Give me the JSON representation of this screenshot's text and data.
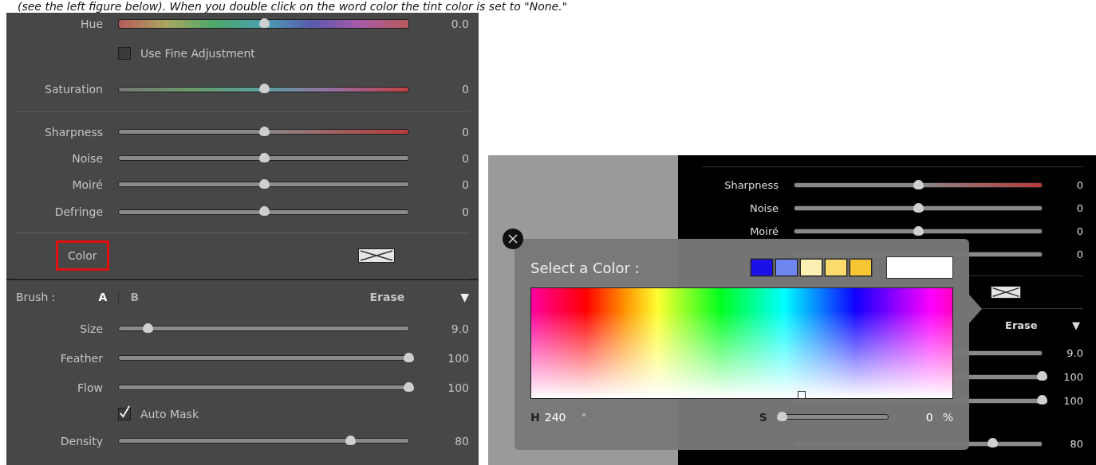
{
  "caption": "(see the left figure below).  When you double click on the word color the tint color is set to \"None.\"",
  "left_panel": {
    "sections": [
      {
        "rows": [
          {
            "kind": "hue",
            "label": "Hue",
            "level": 0.5,
            "value": "0.0"
          },
          {
            "kind": "checkbox",
            "label": "Use Fine Adjustment",
            "checked": false
          },
          {
            "kind": "saturation",
            "label": "Saturation",
            "level": 0.5,
            "value": "0"
          }
        ]
      },
      {
        "rows": [
          {
            "kind": "tinted",
            "label": "Sharpness",
            "level": 0.5,
            "value": "0"
          },
          {
            "kind": "slider",
            "label": "Noise",
            "level": 0.5,
            "value": "0"
          },
          {
            "kind": "slider",
            "label": "Moiré",
            "level": 0.5,
            "value": "0"
          },
          {
            "kind": "slider",
            "label": "Defringe",
            "level": 0.5,
            "value": "0"
          }
        ]
      },
      {
        "rows": [
          {
            "kind": "color",
            "label": "Color",
            "highlighted": true
          }
        ]
      }
    ],
    "brush": {
      "label": "Brush :",
      "options": [
        {
          "label": "A",
          "selected": true
        },
        {
          "label": "B",
          "selected": false
        }
      ],
      "erase": "Erase",
      "menu": "▼"
    },
    "brush_rows": [
      {
        "kind": "slider",
        "label": "Size",
        "level": 0.1,
        "value": "9.0"
      },
      {
        "kind": "slider",
        "label": "Feather",
        "level": 1.0,
        "value": "100"
      },
      {
        "kind": "slider",
        "label": "Flow",
        "level": 1.0,
        "value": "100"
      },
      {
        "kind": "checkbox",
        "label": "Auto Mask",
        "checked": true
      },
      {
        "kind": "slider",
        "label": "Density",
        "level": 0.8,
        "value": "80"
      }
    ]
  },
  "right_panel": {
    "detail_rows": [
      {
        "kind": "tinted",
        "label": "Sharpness",
        "level": 0.5,
        "value": "0"
      },
      {
        "kind": "slider",
        "label": "Noise",
        "level": 0.5,
        "value": "0"
      },
      {
        "kind": "slider",
        "label": "Moiré",
        "level": 0.5,
        "value": "0"
      },
      {
        "kind": "slider",
        "value": "0"
      }
    ],
    "brush": {
      "erase": "Erase",
      "menu": "▼"
    },
    "brush_rows": [
      {
        "value": "9.0"
      },
      {
        "level": 1.0,
        "value": "100"
      },
      {
        "level": 1.0,
        "value": "100"
      },
      {
        "level": 0.8,
        "value": "80"
      }
    ]
  },
  "color_picker": {
    "title": "Select a Color :",
    "swatches": [
      {
        "color": "#1a10e8"
      },
      {
        "color": "#6f86f0"
      },
      {
        "color": "#fdf0b4"
      },
      {
        "color": "#fbdc6c"
      },
      {
        "color": "#f8c535"
      }
    ],
    "preview": {
      "color": "#ffffff"
    },
    "hue": {
      "label": "H",
      "value": "240",
      "unit": "°"
    },
    "saturation": {
      "label": "S",
      "level": 0.0,
      "value": "0",
      "unit": "%"
    }
  }
}
